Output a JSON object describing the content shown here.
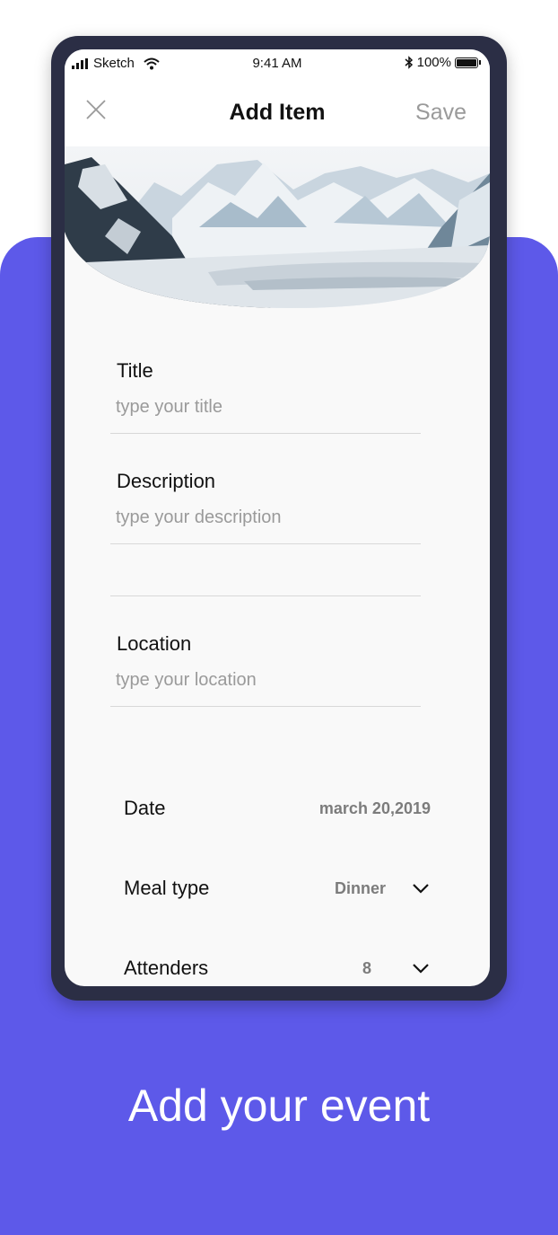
{
  "colors": {
    "accent": "#5d59e9",
    "phone_frame": "#2b2e45",
    "screen_bg": "#f9f9f9",
    "muted_text": "#9a9a9a",
    "value_text": "#7c7c7c"
  },
  "status_bar": {
    "carrier": "Sketch",
    "time": "9:41 AM",
    "battery": "100%",
    "icons": [
      "signal-icon",
      "wifi-icon",
      "bluetooth-icon",
      "battery-icon"
    ]
  },
  "navbar": {
    "close_icon": "close-icon",
    "title": "Add Item",
    "save_label": "Save"
  },
  "form": {
    "title": {
      "label": "Title",
      "placeholder": "type your title"
    },
    "description": {
      "label": "Description",
      "placeholder": "type your description"
    },
    "location": {
      "label": "Location",
      "placeholder": "type your location"
    }
  },
  "options": {
    "date": {
      "label": "Date",
      "value": "march 20,2019"
    },
    "meal_type": {
      "label": "Meal type",
      "value": "Dinner",
      "icon": "chevron-down-icon"
    },
    "attenders": {
      "label": "Attenders",
      "value": "8",
      "icon": "chevron-down-icon"
    }
  },
  "caption": "Add your event"
}
